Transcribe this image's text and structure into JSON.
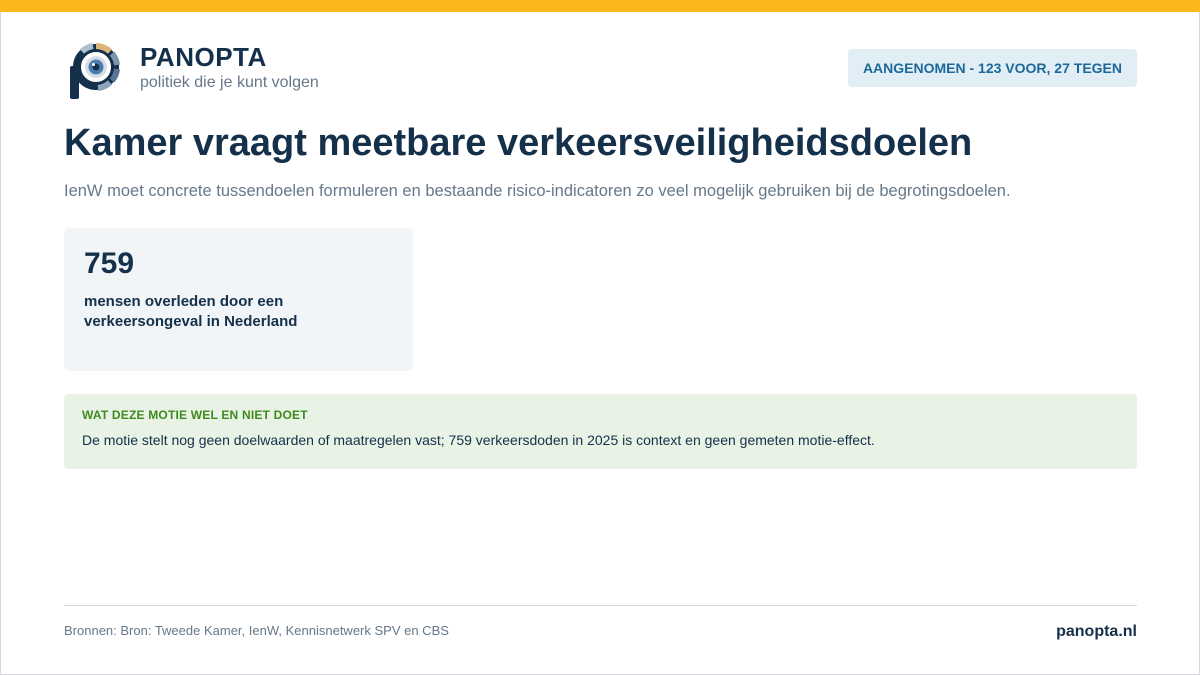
{
  "brand": {
    "name": "PANOPTA",
    "tagline": "politiek die je kunt volgen"
  },
  "status": {
    "label": "AANGENOMEN - 123 VOOR, 27 TEGEN"
  },
  "article": {
    "title": "Kamer vraagt meetbare verkeersveiligheidsdoelen",
    "subtitle": "IenW moet concrete tussendoelen formuleren en bestaande risico-indicatoren zo veel mogelijk gebruiken bij de begrotingsdoelen."
  },
  "stat": {
    "value": "759",
    "label": "mensen overleden door een verkeersongeval in Nederland"
  },
  "note": {
    "heading": "WAT DEZE MOTIE WEL EN NIET DOET",
    "text": "De motie stelt nog geen doelwaarden of maatregelen vast; 759 verkeersdoden in 2025 is context en geen gemeten motie-effect."
  },
  "footer": {
    "sources": "Bronnen: Bron: Tweede Kamer, IenW, Kennisnetwerk SPV en CBS",
    "site": "panopta.nl"
  },
  "colors": {
    "accent": "#fbb81d",
    "navy": "#15304a",
    "muted": "#66788a",
    "badge_bg": "#e2eef6",
    "badge_text": "#1b6996",
    "note_bg": "#e8f3e5",
    "note_heading": "#3f8a1e"
  },
  "icons": {
    "logo": "panopta-eye-logo-icon"
  }
}
